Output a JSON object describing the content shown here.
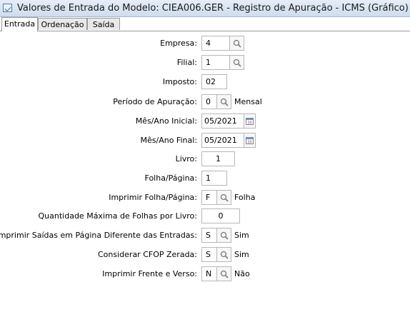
{
  "window": {
    "title": "Valores de Entrada do Modelo: CIEA006.GER - Registro de Apuração - ICMS (Gráfico)"
  },
  "tabs": [
    {
      "label": "Entrada",
      "active": true
    },
    {
      "label": "Ordenação",
      "active": false
    },
    {
      "label": "Saída",
      "active": false
    }
  ],
  "form": {
    "empresa": {
      "label": "Empresa:",
      "value": "4"
    },
    "filial": {
      "label": "Filial:",
      "value": "1"
    },
    "imposto": {
      "label": "Imposto:",
      "value": "02"
    },
    "periodo": {
      "label": "Período de Apuração:",
      "value": "0",
      "description": "Mensal"
    },
    "mes_inicial": {
      "label": "Mês/Ano Inicial:",
      "value": "05/2021"
    },
    "mes_final": {
      "label": "Mês/Ano Final:",
      "value": "05/2021"
    },
    "livro": {
      "label": "Livro:",
      "value": "1"
    },
    "folha": {
      "label": "Folha/Página:",
      "value": "1"
    },
    "imprimir_folha": {
      "label": "Imprimir Folha/Página:",
      "value": "F",
      "description": "Folha"
    },
    "qtd_max": {
      "label": "Quantidade Máxima de Folhas por Livro:",
      "value": "0"
    },
    "saidas_pagina": {
      "label": "Imprimir Saídas em Página Diferente das Entradas:",
      "value": "S",
      "description": "Sim"
    },
    "cfop_zerada": {
      "label": "Considerar CFOP Zerada:",
      "value": "S",
      "description": "Sim"
    },
    "frente_verso": {
      "label": "Imprimir Frente e Verso:",
      "value": "N",
      "description": "Não"
    }
  }
}
